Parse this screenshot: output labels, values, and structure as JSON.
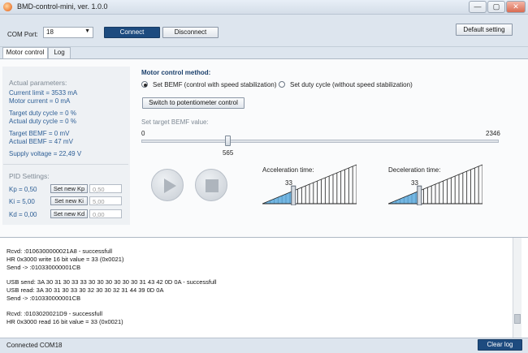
{
  "window": {
    "title": "BMD-control-mini, ver. 1.0.0",
    "min": "—",
    "max": "▢",
    "close": "✕"
  },
  "toolbar": {
    "com_port_label": "COM Port:",
    "com_port_value": "18",
    "connect": "Connect",
    "disconnect": "Disconnect",
    "default_setting": "Default setting"
  },
  "tabs": [
    {
      "label": "Motor control"
    },
    {
      "label": "Log"
    }
  ],
  "actual": {
    "heading": "Actual parameters:",
    "lines": [
      "Current limit = 3533 mA",
      "Motor current = 0 mA",
      "Target duty cycle = 0 %",
      "Actual duty cycle = 0 %",
      "Target BEMF = 0 mV",
      "Actual BEMF = 47 mV",
      "Supply voltage = 22,49 V"
    ]
  },
  "pid": {
    "heading": "PID Settings:",
    "rows": [
      {
        "label": "Kp = 0,50",
        "button": "Set new Kp",
        "value": "0,50"
      },
      {
        "label": "Ki = 5,00",
        "button": "Set new Ki",
        "value": "5,00"
      },
      {
        "label": "Kd = 0,00",
        "button": "Set new Kd",
        "value": "0,00"
      }
    ]
  },
  "motor": {
    "heading": "Motor control method:",
    "option_bemf": "Set BEMF (control with speed stabilization)",
    "option_duty": "Set duty cycle (without speed stabilization)",
    "switch_button": "Switch to potentiometer control",
    "target_label": "Set target BEMF value:",
    "slider_min": "0",
    "slider_max": "2346",
    "slider_value": 565,
    "slider_value_label": "565",
    "accel_label": "Acceleration time:",
    "accel_value": "33",
    "accel_fraction": 0.33,
    "decel_label": "Deceleration time:",
    "decel_value": "33",
    "decel_fraction": 0.33
  },
  "log": [
    "Rcvd: :0106300000021A8 - successfull",
    "HR 0x3000 write  16 bit value = 33 (0x0021)",
    "Send -> :010330000001CB",
    "",
    "USB send: 3A 30 31 30 33 33 30 30 30 30 30 30 31 43 42 0D 0A  - successfull",
    "USB read: 3A 30 31 30 33 30 32 30 30 32 31 44 39 0D 0A",
    "Send -> :010330000001CB",
    "",
    "Rcvd: :0103020021D9 - successfull",
    "HR 0x3000 read  16 bit value = 33 (0x0021)"
  ],
  "status": {
    "text": "Connected COM18",
    "clear_log": "Clear log"
  },
  "colors": {
    "accent": "#1d4b7f",
    "param_text": "#2e5f96",
    "ramp_fill": "#5aa9dd"
  }
}
